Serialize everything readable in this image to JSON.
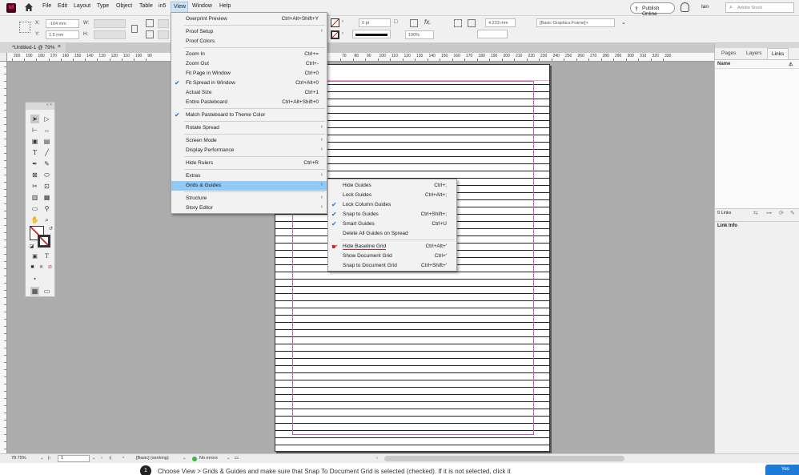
{
  "menubar": {
    "items": [
      "File",
      "Edit",
      "Layout",
      "Type",
      "Object",
      "Table",
      "in5",
      "View",
      "Window",
      "Help"
    ],
    "publish_label": "Publish Online",
    "user_name": "Ian",
    "stock_placeholder": "Adobe Stock"
  },
  "controlbar": {
    "x_label": "X:",
    "x_value": "-104 mm",
    "y_label": "Y:",
    "y_value": "1.5 mm",
    "w_label": "W:",
    "h_label": "H:",
    "stroke_weight": "0 pt",
    "zoom_percent": "100%",
    "dimension": "4.233 mm",
    "frame_style": "[Basic Graphics Frame]+"
  },
  "document": {
    "tab_title": "*Untitled-1 @ 79%"
  },
  "ruler": {
    "left_numbers": [
      "200",
      "190",
      "180",
      "170",
      "160",
      "150",
      "140",
      "130",
      "120",
      "110",
      "100",
      "90"
    ],
    "right_numbers": [
      "70",
      "80",
      "90",
      "100",
      "110",
      "120",
      "130",
      "140",
      "150",
      "160",
      "170",
      "180",
      "190",
      "200",
      "210",
      "220",
      "230",
      "240",
      "250",
      "260",
      "270",
      "280",
      "290",
      "300",
      "310",
      "320",
      "330"
    ]
  },
  "view_menu": {
    "items": [
      {
        "label": "Overprint Preview",
        "shortcut": "Ctrl+Alt+Shift+Y",
        "checked": false,
        "submenu": false
      },
      {
        "label": "Proof Setup",
        "shortcut": "",
        "checked": false,
        "submenu": true
      },
      {
        "label": "Proof Colors",
        "shortcut": "",
        "checked": false,
        "submenu": false
      },
      {
        "label": "Zoom In",
        "shortcut": "Ctrl+=",
        "checked": false,
        "submenu": false
      },
      {
        "label": "Zoom Out",
        "shortcut": "Ctrl+-",
        "checked": false,
        "submenu": false
      },
      {
        "label": "Fit Page in Window",
        "shortcut": "Ctrl+0",
        "checked": false,
        "submenu": false
      },
      {
        "label": "Fit Spread in Window",
        "shortcut": "Ctrl+Alt+0",
        "checked": true,
        "submenu": false
      },
      {
        "label": "Actual Size",
        "shortcut": "Ctrl+1",
        "checked": false,
        "submenu": false
      },
      {
        "label": "Entire Pasteboard",
        "shortcut": "Ctrl+Alt+Shift+0",
        "checked": false,
        "submenu": false
      },
      {
        "label": "Match Pasteboard to Theme Color",
        "shortcut": "",
        "checked": true,
        "submenu": false
      },
      {
        "label": "Rotate Spread",
        "shortcut": "",
        "checked": false,
        "submenu": true
      },
      {
        "label": "Screen Mode",
        "shortcut": "",
        "checked": false,
        "submenu": true
      },
      {
        "label": "Display Performance",
        "shortcut": "",
        "checked": false,
        "submenu": true
      },
      {
        "label": "Hide Rulers",
        "shortcut": "Ctrl+R",
        "checked": false,
        "submenu": false
      },
      {
        "label": "Extras",
        "shortcut": "",
        "checked": false,
        "submenu": true
      },
      {
        "label": "Grids & Guides",
        "shortcut": "",
        "checked": false,
        "submenu": true,
        "highlighted": true
      },
      {
        "label": "Structure",
        "shortcut": "",
        "checked": false,
        "submenu": true
      },
      {
        "label": "Story Editor",
        "shortcut": "",
        "checked": false,
        "submenu": true
      }
    ]
  },
  "grids_menu": {
    "items": [
      {
        "label": "Hide Guides",
        "shortcut": "Ctrl+;",
        "checked": false
      },
      {
        "label": "Lock Guides",
        "shortcut": "Ctrl+Alt+;",
        "checked": false
      },
      {
        "label": "Lock Column Guides",
        "shortcut": "",
        "checked": true
      },
      {
        "label": "Snap to Guides",
        "shortcut": "Ctrl+Shift+;",
        "checked": true
      },
      {
        "label": "Smart Guides",
        "shortcut": "Ctrl+U",
        "checked": true
      },
      {
        "label": "Delete All Guides on Spread",
        "shortcut": "",
        "checked": false
      },
      {
        "label": "Hide Baseline Grid",
        "shortcut": "Ctrl+Alt+'",
        "checked": false,
        "annotated": true
      },
      {
        "label": "Show Document Grid",
        "shortcut": "Ctrl+'",
        "checked": false
      },
      {
        "label": "Snap to Document Grid",
        "shortcut": "Ctrl+Shift+'",
        "checked": false
      }
    ]
  },
  "right_panel": {
    "tabs": [
      "Pages",
      "Layers",
      "Links"
    ],
    "column_name": "Name",
    "links_count": "0 Links",
    "link_info": "Link Info"
  },
  "statusbar": {
    "zoom": "78.75%",
    "page": "1",
    "profile": "[Basic] (working)",
    "errors": "No errors"
  },
  "caption": {
    "step": "1",
    "text": "Choose View > Grids & Guides and make sure that Snap To Document Grid is selected (checked). If it is not selected, click it",
    "yes_label": "Yes"
  },
  "colors": {
    "menu_highlight": "#91c9f7",
    "check_blue": "#1a6fd6",
    "margin_guide": "#c060c0",
    "annotation_red": "#d0202a"
  }
}
